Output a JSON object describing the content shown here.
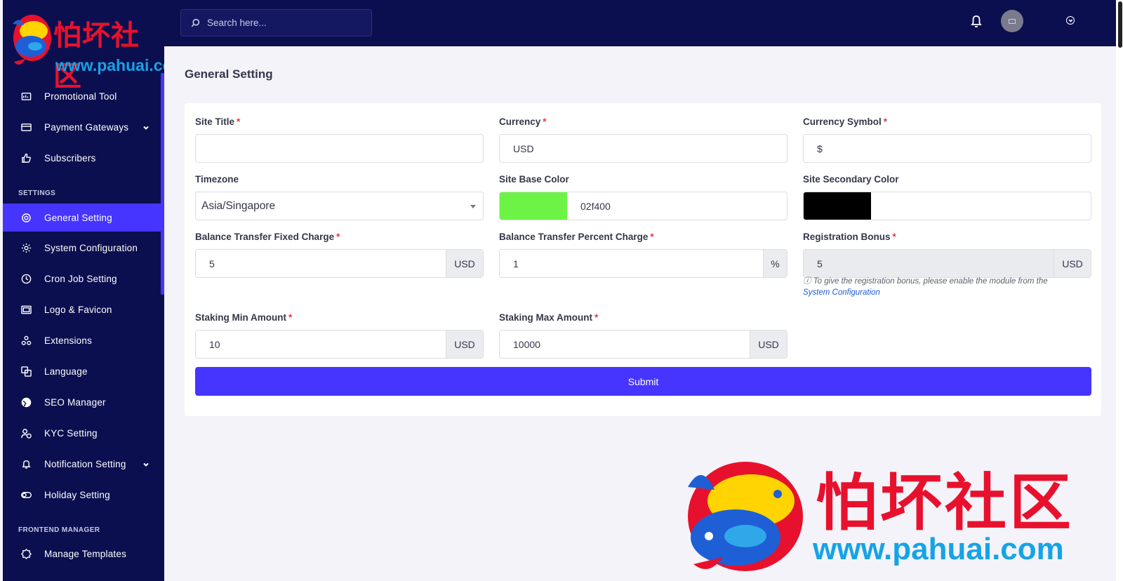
{
  "logo": {
    "cn": "怕坏社区",
    "url": "www.pahuai.com"
  },
  "sidebar": {
    "items": [
      {
        "label": "Promotional Tool",
        "icon": "promo-icon"
      },
      {
        "label": "Payment Gateways",
        "icon": "credit-card-icon"
      },
      {
        "label": "Subscribers",
        "icon": "thumbs-up-icon"
      },
      {
        "label": "General Setting",
        "icon": "general-setting-icon"
      },
      {
        "label": "System Configuration",
        "icon": "gear-icon"
      },
      {
        "label": "Cron Job Setting",
        "icon": "clock-icon"
      },
      {
        "label": "Logo & Favicon",
        "icon": "image-icon"
      },
      {
        "label": "Extensions",
        "icon": "extensions-icon"
      },
      {
        "label": "Language",
        "icon": "language-icon"
      },
      {
        "label": "SEO Manager",
        "icon": "globe-icon"
      },
      {
        "label": "KYC Setting",
        "icon": "user-check-icon"
      },
      {
        "label": "Notification Setting",
        "icon": "bell-icon"
      },
      {
        "label": "Holiday Setting",
        "icon": "toggle-icon"
      },
      {
        "label": "Manage Templates",
        "icon": "templates-icon"
      }
    ],
    "sections": {
      "settings": "SETTINGS",
      "frontend": "FRONTEND MANAGER"
    }
  },
  "topbar": {
    "search_placeholder": "Search here..."
  },
  "page": {
    "title": "General Setting"
  },
  "form": {
    "site_title": {
      "label": "Site Title",
      "value": ""
    },
    "currency": {
      "label": "Currency",
      "value": "USD"
    },
    "currency_symbol": {
      "label": "Currency Symbol",
      "value": "$"
    },
    "timezone": {
      "label": "Timezone",
      "value": "Asia/Singapore"
    },
    "base_color": {
      "label": "Site Base Color",
      "value": "02f400",
      "swatch": "#6cf346"
    },
    "secondary_color": {
      "label": "Site Secondary Color",
      "value": "",
      "swatch": "#000000"
    },
    "bt_fixed": {
      "label": "Balance Transfer Fixed Charge",
      "value": "5",
      "addon": "USD"
    },
    "bt_percent": {
      "label": "Balance Transfer Percent Charge",
      "value": "1",
      "addon": "%"
    },
    "reg_bonus": {
      "label": "Registration Bonus",
      "value": "5",
      "addon": "USD",
      "hint": "To give the registration bonus, please enable the module from the",
      "hint_link": "System Configuration"
    },
    "stake_min": {
      "label": "Staking Min Amount",
      "value": "10",
      "addon": "USD"
    },
    "stake_max": {
      "label": "Staking Max Amount",
      "value": "10000",
      "addon": "USD"
    },
    "required_mark": "*",
    "submit": "Submit"
  },
  "watermark": {
    "cn": "怕坏社区",
    "url": "www.pahuai.com"
  },
  "colors": {
    "sidebar": "#0b0f4f",
    "accent": "#4634ff",
    "background": "#f3f3f9"
  }
}
